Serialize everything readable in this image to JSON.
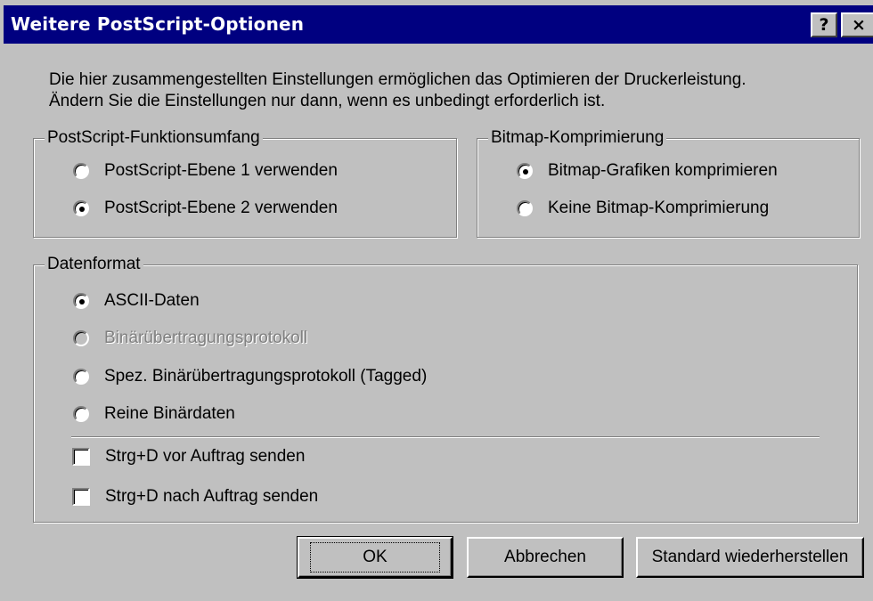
{
  "window": {
    "title": "Weitere PostScript-Optionen",
    "help_button": "?",
    "close_button": "×"
  },
  "intro": {
    "line1": "Die hier zusammengestellten Einstellungen ermöglichen das Optimieren der Druckerleistung.",
    "line2": "Ändern Sie die Einstellungen nur dann, wenn es unbedingt erforderlich ist."
  },
  "postscript_group": {
    "legend": "PostScript-Funktionsumfang",
    "options": [
      {
        "label": "PostScript-Ebene 1 verwenden",
        "checked": false
      },
      {
        "label": "PostScript-Ebene 2 verwenden",
        "checked": true
      }
    ]
  },
  "bitmap_group": {
    "legend": "Bitmap-Komprimierung",
    "options": [
      {
        "label": "Bitmap-Grafiken komprimieren",
        "checked": true
      },
      {
        "label": "Keine Bitmap-Komprimierung",
        "checked": false
      }
    ]
  },
  "data_format_group": {
    "legend": "Datenformat",
    "options": [
      {
        "label": "ASCII-Daten",
        "checked": true,
        "disabled": false
      },
      {
        "label": "Binärübertragungsprotokoll",
        "checked": false,
        "disabled": true
      },
      {
        "label": "Spez. Binärübertragungsprotokoll (Tagged)",
        "checked": false,
        "disabled": false
      },
      {
        "label": "Reine Binärdaten",
        "checked": false,
        "disabled": false
      }
    ],
    "checkboxes": [
      {
        "label": "Strg+D vor Auftrag senden",
        "checked": false
      },
      {
        "label": "Strg+D nach Auftrag senden",
        "checked": false
      }
    ]
  },
  "buttons": {
    "ok": "OK",
    "cancel": "Abbrechen",
    "restore": "Standard wiederherstellen"
  }
}
